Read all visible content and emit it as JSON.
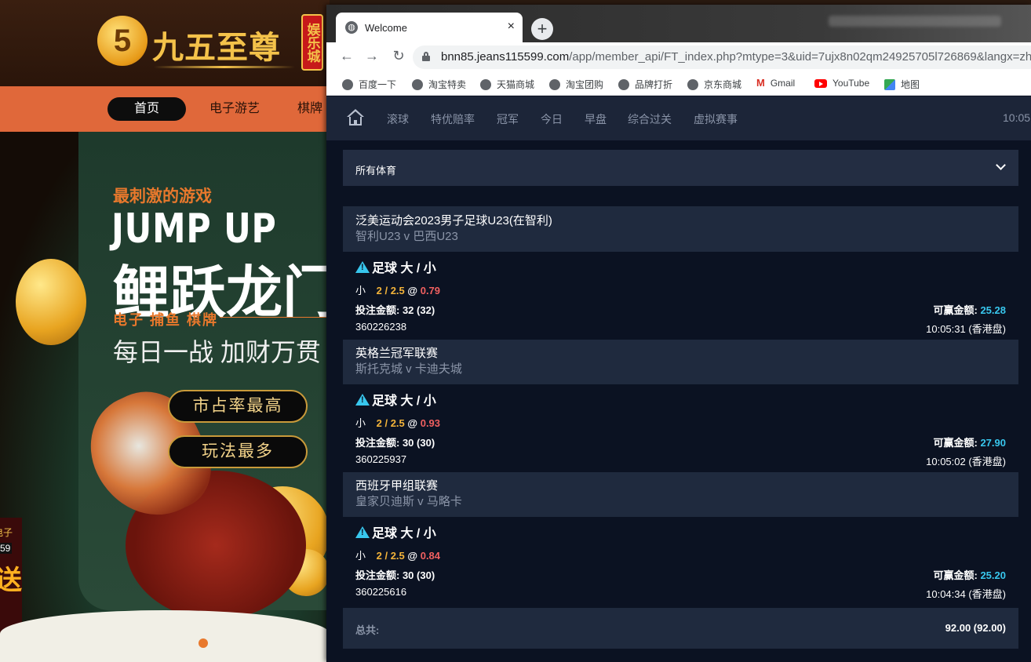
{
  "background_site": {
    "logo_mark": "5",
    "logo_name": "九五至尊",
    "logo_badge": "娱乐城",
    "nav": [
      "首页",
      "电子游艺",
      "棋牌"
    ],
    "hero": {
      "subtitle": "最刺激的游戏",
      "headline_en": "JUMP UP",
      "headline_cn": "鲤跃龙门",
      "tags": "电子  捕鱼  棋牌",
      "slogan": "每日一战  加财万贯",
      "buttons": [
        "市占率最高",
        "玩法最多"
      ]
    },
    "side_promo": [
      "电子",
      "59",
      "送"
    ]
  },
  "browser": {
    "tab_title": "Welcome",
    "tab_close": "×",
    "new_tab": "+",
    "url_host": "bnn85.jeans115599.com",
    "url_path": "/app/member_api/FT_index.php?mtype=3&uid=7ujx8n02qm24925705l726869&langx=zh-cn",
    "bookmarks": [
      "百度一下",
      "淘宝特卖",
      "天猫商城",
      "淘宝团购",
      "品牌打折",
      "京东商城",
      "Gmail",
      "YouTube",
      "地图"
    ]
  },
  "page": {
    "nav": [
      "滚球",
      "特优赔率",
      "冠军",
      "今日",
      "早盘",
      "综合过关",
      "虚拟赛事"
    ],
    "time": "10:05",
    "sport_filter": "所有体育",
    "bets": [
      {
        "league": "泛美运动会2023男子足球U23(在智利)",
        "teams": "智利U23   v   巴西U23",
        "market": "足球 大 / 小",
        "selection": "小",
        "handicap": "2 / 2.5",
        "at": "@",
        "odds": "0.79",
        "stake_label": "投注金额: ",
        "stake": "32 (32)",
        "win_label": "可赢金额: ",
        "win": "25.28",
        "ticket": "360226238",
        "time": "10:05:31 (香港盘)"
      },
      {
        "league": "英格兰冠军联赛",
        "teams": "斯托克城   v   卡迪夫城",
        "market": "足球 大 / 小",
        "selection": "小",
        "handicap": "2 / 2.5",
        "at": "@",
        "odds": "0.93",
        "stake_label": "投注金额: ",
        "stake": "30 (30)",
        "win_label": "可赢金额: ",
        "win": "27.90",
        "ticket": "360225937",
        "time": "10:05:02 (香港盘)"
      },
      {
        "league": "西班牙甲组联赛",
        "teams": "皇家贝迪斯   v   马略卡",
        "market": "足球 大 / 小",
        "selection": "小",
        "handicap": "2 / 2.5",
        "at": "@",
        "odds": "0.84",
        "stake_label": "投注金额: ",
        "stake": "30 (30)",
        "win_label": "可赢金额: ",
        "win": "25.20",
        "ticket": "360225616",
        "time": "10:04:34 (香港盘)"
      }
    ],
    "total_label": "总共:",
    "total_value": "92.00 (92.00)"
  },
  "colors": {
    "page_bg": "#0b1222",
    "header_bg": "#1f2a3e",
    "accent_cyan": "#38c7ee",
    "handicap_orange": "#f4b43a",
    "odds_red": "#f06060",
    "site_orange": "#e0683a"
  },
  "icons": [
    "home-icon",
    "warning-icon",
    "lock-icon",
    "chevron-down-icon",
    "reload-icon",
    "back-icon",
    "forward-icon"
  ]
}
